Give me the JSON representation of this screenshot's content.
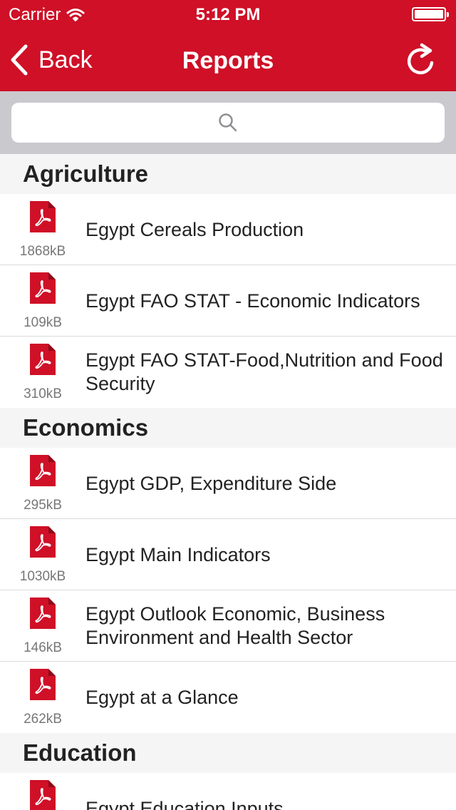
{
  "status": {
    "carrier": "Carrier",
    "time": "5:12 PM"
  },
  "nav": {
    "back_label": "Back",
    "title": "Reports"
  },
  "search": {
    "placeholder": ""
  },
  "colors": {
    "brand_red": "#cf1027",
    "section_bg": "#f5f5f5",
    "search_bar_bg": "#c9c9ce"
  },
  "icons": {
    "report": "pdf-icon",
    "search": "search-icon",
    "refresh": "refresh-icon",
    "back": "chevron-left-icon"
  },
  "sections": [
    {
      "title": "Agriculture",
      "items": [
        {
          "title": "Egypt Cereals Production",
          "size": "1868kB"
        },
        {
          "title": "Egypt FAO STAT - Economic Indicators",
          "size": "109kB"
        },
        {
          "title": "Egypt FAO STAT-Food,Nutrition and Food Security",
          "size": "310kB"
        }
      ]
    },
    {
      "title": "Economics",
      "items": [
        {
          "title": "Egypt GDP, Expenditure Side",
          "size": "295kB"
        },
        {
          "title": "Egypt Main Indicators",
          "size": "1030kB"
        },
        {
          "title": "Egypt Outlook Economic, Business Environment and Health Sector",
          "size": "146kB"
        },
        {
          "title": "Egypt at a Glance",
          "size": "262kB"
        }
      ]
    },
    {
      "title": "Education",
      "items": [
        {
          "title": "Egypt Education Inputs",
          "size": ""
        }
      ]
    }
  ]
}
